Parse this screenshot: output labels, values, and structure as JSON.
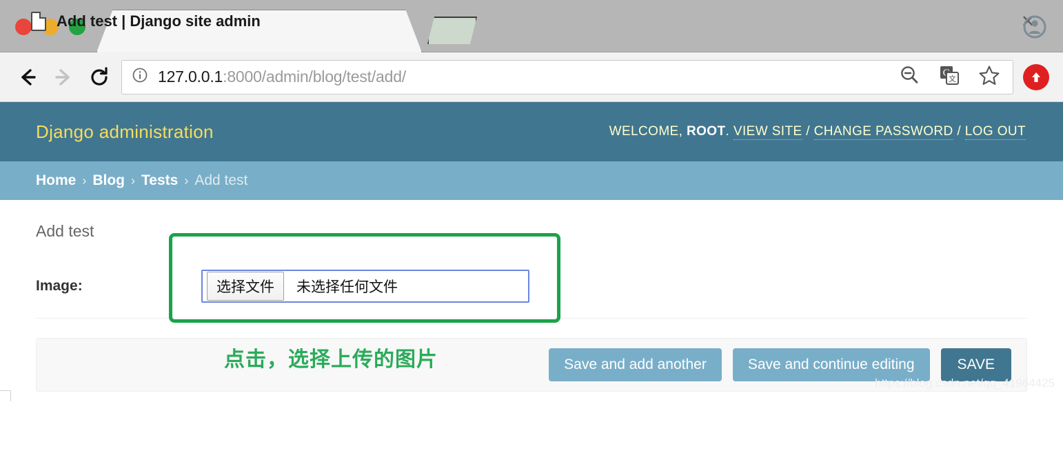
{
  "browser": {
    "tab": {
      "title": "Add test | Django site admin",
      "favicon_icon": "document-icon",
      "close_icon": "close-icon"
    },
    "traffic_lights": [
      "close-red",
      "minimize-yellow",
      "zoom-green"
    ],
    "avatar_icon": "account-avatar-icon",
    "toolbar": {
      "back_icon": "back-arrow-icon",
      "forward_icon": "forward-arrow-icon",
      "reload_icon": "reload-icon",
      "info_icon": "page-info-icon",
      "url_host": "127.0.0.1",
      "url_path": ":8000/admin/blog/test/add/",
      "zoom_out_icon": "zoom-out-icon",
      "translate_icon": "google-translate-icon",
      "bookmark_icon": "star-bookmark-icon",
      "extension_icon": "red-upload-extension-icon"
    }
  },
  "admin": {
    "branding": "Django administration",
    "user_tools": {
      "welcome_prefix": "WELCOME,",
      "username": "ROOT",
      "period": ".",
      "view_site": "VIEW SITE",
      "sep1": "/",
      "change_password": "CHANGE PASSWORD",
      "sep2": "/",
      "log_out": "LOG OUT"
    },
    "breadcrumbs": {
      "home": "Home",
      "app": "Blog",
      "model": "Tests",
      "current": "Add test",
      "separator": "›"
    },
    "page_title": "Add test",
    "form": {
      "image_label": "Image:",
      "file_button": "选择文件",
      "file_status": "未选择任何文件"
    },
    "annotation": {
      "text": "点击，选择上传的图片",
      "color": "#2bab5a",
      "box_color": "#1aa34a"
    },
    "buttons": {
      "save_add_another": "Save and add another",
      "save_continue": "Save and continue editing",
      "save": "SAVE"
    },
    "colors": {
      "header": "#417690",
      "breadcrumb": "#79aec8",
      "branding_text": "#f5dd5d",
      "primary_button": "#79aec8",
      "save_button": "#417690"
    }
  },
  "watermark": "https://blog.csdn.net/qq_41964425"
}
